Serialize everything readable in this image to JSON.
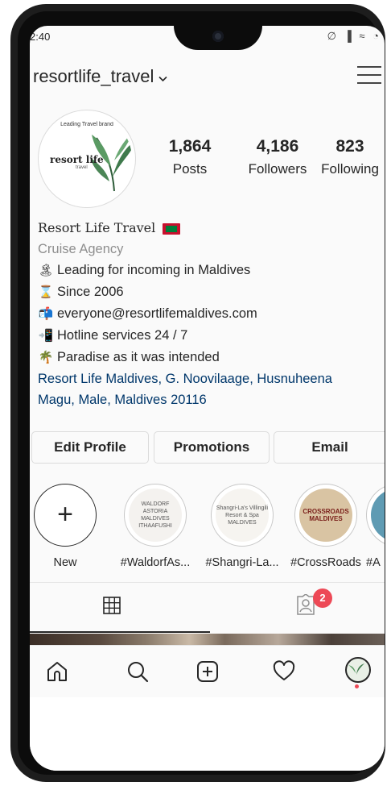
{
  "status_bar": {
    "time": "2:40",
    "icons": "∅ ▐ ≈ ◔"
  },
  "header": {
    "username": "resortlife_travel",
    "chevron": "⌵"
  },
  "avatar": {
    "top_text": "Leading Travel brand",
    "brand": "resort life",
    "sub": "travel"
  },
  "stats": [
    {
      "num": "1,864",
      "label": "Posts"
    },
    {
      "num": "4,186",
      "label": "Followers"
    },
    {
      "num": "823",
      "label": "Following"
    }
  ],
  "bio": {
    "name": "Resort Life Travel",
    "category": "Cruise Agency",
    "lines": [
      {
        "emoji": "🏝",
        "text": "Leading for incoming in Maldives"
      },
      {
        "emoji": "⌛",
        "text": "Since 2006"
      },
      {
        "emoji": "📬",
        "text": "everyone@resortlifemaldives.com"
      },
      {
        "emoji": "📲",
        "text": "Hotline services 24 / 7"
      },
      {
        "emoji": "🌴",
        "text": "Paradise as it was intended"
      }
    ],
    "address_line1": "Resort Life Maldives, G. Noovilaage, Husnuheena",
    "address_line2": "Magu, Male, Maldives 20116"
  },
  "buttons": {
    "edit_profile": "Edit Profile",
    "promotions": "Promotions",
    "email": "Email"
  },
  "highlights": [
    {
      "label": "New",
      "cover": "+"
    },
    {
      "label": "#WaldorfAs...",
      "cover": "WALDORF ASTORIA MALDIVES ITHAAFUSHI"
    },
    {
      "label": "#Shangri-La...",
      "cover": "Shangri-La's Villingili Resort & Spa MALDIVES"
    },
    {
      "label": "#CrossRoads",
      "cover": "CROSSROADS MALDIVES"
    },
    {
      "label": "#A"
    }
  ],
  "tabs": {
    "tagged_badge": "2"
  },
  "colors": {
    "accent_red": "#ed4956",
    "link_blue": "#00376b",
    "muted": "#8e8e8e"
  }
}
